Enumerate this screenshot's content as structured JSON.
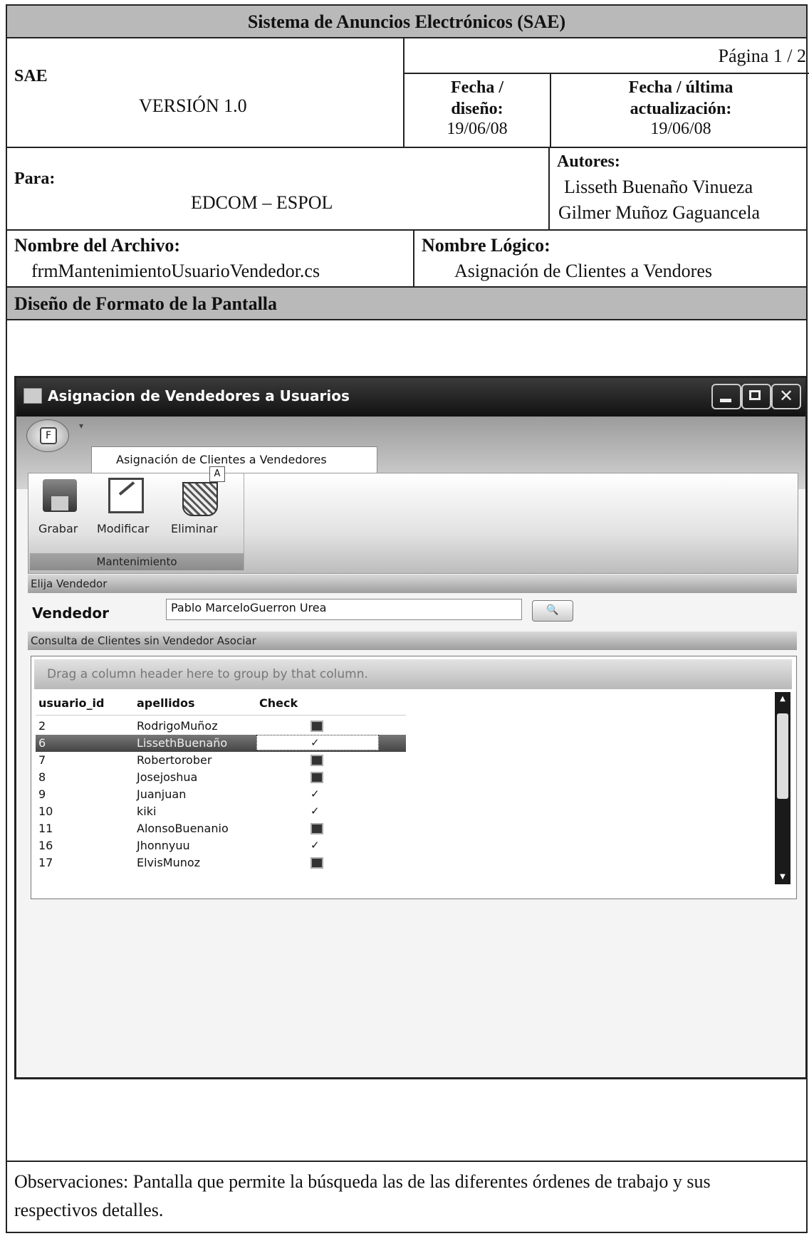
{
  "doc": {
    "system_title": "Sistema de Anuncios Electrónicos (SAE)",
    "page": "Página  1 / 2",
    "app_name": "SAE",
    "version": "VERSIÓN 1.0",
    "fecha_diseno_label": "Fecha / diseño:",
    "fecha_diseno": "19/06/08",
    "fecha_actual_label": "Fecha / última actualización:",
    "fecha_actual": "19/06/08",
    "para_label": "Para:",
    "para_value": "EDCOM – ESPOL",
    "autores_label": "Autores:",
    "autor1": "Lisseth Buenaño Vinueza",
    "autor2": "Gilmer Muñoz Gaguancela",
    "archivo_label": "Nombre del Archivo:",
    "archivo_value": "frmMantenimientoUsuarioVendedor.cs",
    "logico_label": "Nombre Lógico:",
    "logico_value": "Asignación de Clientes a Vendores",
    "section_title": "Diseño de Formato de la Pantalla",
    "observaciones": "Observaciones: Pantalla que permite la búsqueda las de las diferentes órdenes de trabajo y sus respectivos detalles."
  },
  "window": {
    "title": "Asignacion de Vendedores a Usuarios",
    "app_button": "F",
    "tab_label": "Asignación de Clientes a Vendedores",
    "keytip": "A",
    "buttons": {
      "grabar": "Grabar",
      "modificar": "Modificar",
      "eliminar": "Eliminar"
    },
    "group_caption": "Mantenimiento",
    "panel1": "Elija Vendedor",
    "vendedor_label": "Vendedor",
    "vendedor_value": "Pablo MarceloGuerron Urea",
    "panel2": "Consulta de Clientes sin Vendedor Asociar",
    "group_hint": "Drag a column header here to group by that column.",
    "columns": {
      "id": "usuario_id",
      "apellidos": "apellidos",
      "check": "Check"
    },
    "rows": [
      {
        "id": "2",
        "apellidos": "RodrigoMuñoz",
        "checked": false
      },
      {
        "id": "6",
        "apellidos": "LissethBuenaño",
        "checked": true
      },
      {
        "id": "7",
        "apellidos": "Robertorober",
        "checked": false
      },
      {
        "id": "8",
        "apellidos": "Josejoshua",
        "checked": false
      },
      {
        "id": "9",
        "apellidos": "Juanjuan",
        "checked": true
      },
      {
        "id": "10",
        "apellidos": "kiki",
        "checked": true
      },
      {
        "id": "11",
        "apellidos": "AlonsoBuenanio",
        "checked": false
      },
      {
        "id": "16",
        "apellidos": "Jhonnyuu",
        "checked": true
      },
      {
        "id": "17",
        "apellidos": "ElvisMunoz",
        "checked": false
      }
    ],
    "check_glyph": "✓"
  }
}
